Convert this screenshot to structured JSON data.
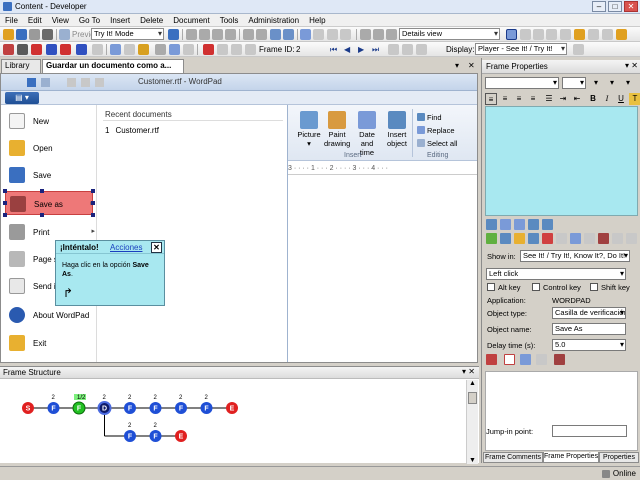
{
  "window": {
    "title": "Content - Developer"
  },
  "menu": [
    "File",
    "Edit",
    "View",
    "Go To",
    "Insert",
    "Delete",
    "Document",
    "Tools",
    "Administration",
    "Help"
  ],
  "toolbar": {
    "preview_label": "Preview",
    "mode_value": "Try It! Mode",
    "view_value": "Details view",
    "frame_id_label": "Frame ID:",
    "frame_id_value": "2",
    "display_label": "Display:",
    "display_value": "Player - See It! / Try It!"
  },
  "tabs": {
    "library": "Library",
    "document": "Guardar un documento como a..."
  },
  "capture": {
    "wordpad_title": "Customer.rtf - WordPad",
    "app_button": "",
    "menu_items": [
      "New",
      "Open",
      "Save",
      "Save as",
      "Print",
      "Page s",
      "Send i",
      "About WordPad",
      "Exit"
    ],
    "recent_heading": "Recent documents",
    "recent_items": [
      {
        "num": "1",
        "name": "Customer.rtf"
      }
    ],
    "ribbon": {
      "picture": "Picture",
      "paint": "Paint",
      "paint2": "drawing",
      "datetime": "Date and",
      "datetime2": "time",
      "insertobj": "Insert",
      "insertobj2": "object",
      "find": "Find",
      "replace": "Replace",
      "selectall": "Select all",
      "group_insert": "Insert",
      "group_editing": "Editing"
    },
    "ruler_text": "3 · · · · 1 · · · 2 · · · · 3 · · · 4 · · ·"
  },
  "callout": {
    "title": "¡Inténtalo!",
    "link": "Acciones",
    "close": "✕",
    "body_pre": "Haga clic en la opción ",
    "body_bold": "Save As",
    "body_post": "."
  },
  "frame_props": {
    "header": "Frame Properties",
    "show_in_label": "Show in:",
    "show_in_value": "See It! / Try It!, Know It?, Do It!",
    "action_value": "Left click",
    "alt_key": "Alt key",
    "control_key": "Control key",
    "shift_key": "Shift key",
    "application_label": "Application:",
    "application_value": "WORDPAD",
    "object_type_label": "Object type:",
    "object_type_value": "Casilla de verificación",
    "object_name_label": "Object name:",
    "object_name_value": "Save As",
    "delay_label": "Delay time (s):",
    "delay_value": "5.0",
    "jump_label": "Jump-in point:",
    "tabs": [
      "Frame Comments",
      "Frame Properties",
      "Properties"
    ]
  },
  "frame_structure": {
    "header": "Frame Structure",
    "nodes_top": [
      {
        "type": "s",
        "label": "S",
        "num": ""
      },
      {
        "type": "f",
        "label": "F",
        "num": "2"
      },
      {
        "type": "g",
        "label": "F",
        "num": "1/2"
      },
      {
        "type": "d",
        "label": "D",
        "num": "2"
      },
      {
        "type": "f",
        "label": "F",
        "num": "2"
      },
      {
        "type": "f",
        "label": "F",
        "num": "2"
      },
      {
        "type": "f",
        "label": "F",
        "num": "2"
      },
      {
        "type": "f",
        "label": "F",
        "num": "2"
      },
      {
        "type": "e",
        "label": "E",
        "num": ""
      }
    ],
    "nodes_bottom": [
      {
        "type": "f",
        "label": "F",
        "num": "2"
      },
      {
        "type": "f",
        "label": "F",
        "num": "2"
      },
      {
        "type": "e",
        "label": "E",
        "num": ""
      }
    ]
  },
  "status": {
    "online": "Online"
  },
  "colors": {
    "callout_bg": "#a8e8f0",
    "highlight": "#eb6060",
    "node_blue": "#1f4fd6",
    "node_red": "#e02020",
    "node_green": "#22c022"
  }
}
